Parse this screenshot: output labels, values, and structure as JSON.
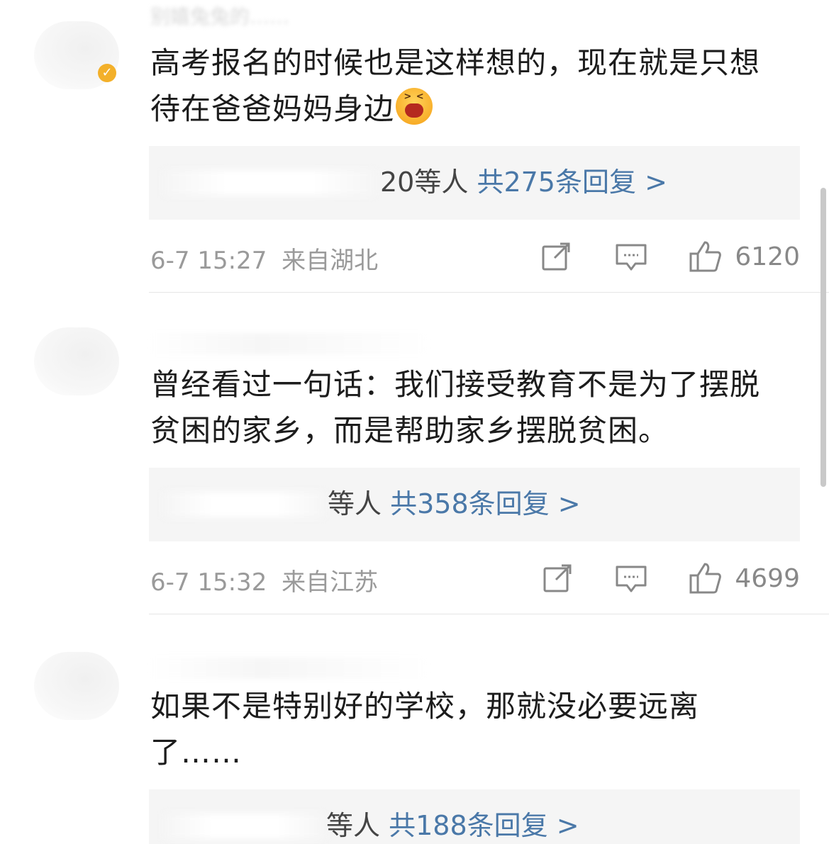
{
  "comments": [
    {
      "username_partial": "别嬉兔兔的……",
      "text_line1": "高考报名的时候也是这样想的，现在就是只想",
      "text_line2": "待在爸爸妈妈身边",
      "emoji": "crying-face",
      "replies_tail": "20等人",
      "replies_count": "共275条回复 >",
      "time": "6-7 15:27",
      "location": "来自湖北",
      "likes": "6120"
    },
    {
      "text_line1": "曾经看过一句话：我们接受教育不是为了摆脱",
      "text_line2": "贫困的家乡，而是帮助家乡摆脱贫困。",
      "replies_tail": "等人",
      "replies_count": "共358条回复 >",
      "time": "6-7 15:32",
      "location": "来自江苏",
      "likes": "4699"
    },
    {
      "text_line1": "如果不是特别好的学校，那就没必要远离",
      "text_line2": "了……",
      "replies_tail": "等人",
      "replies_count": "共188条回复 >"
    }
  ],
  "colors": {
    "link": "#4a78a8",
    "meta": "#9a9a9a",
    "reply_bg": "#f5f5f5",
    "badge": "#f3b02a"
  },
  "icons": {
    "repost": "repost-icon",
    "comment": "comment-icon",
    "like": "thumbs-up-icon",
    "verified": "verified-badge-icon"
  }
}
